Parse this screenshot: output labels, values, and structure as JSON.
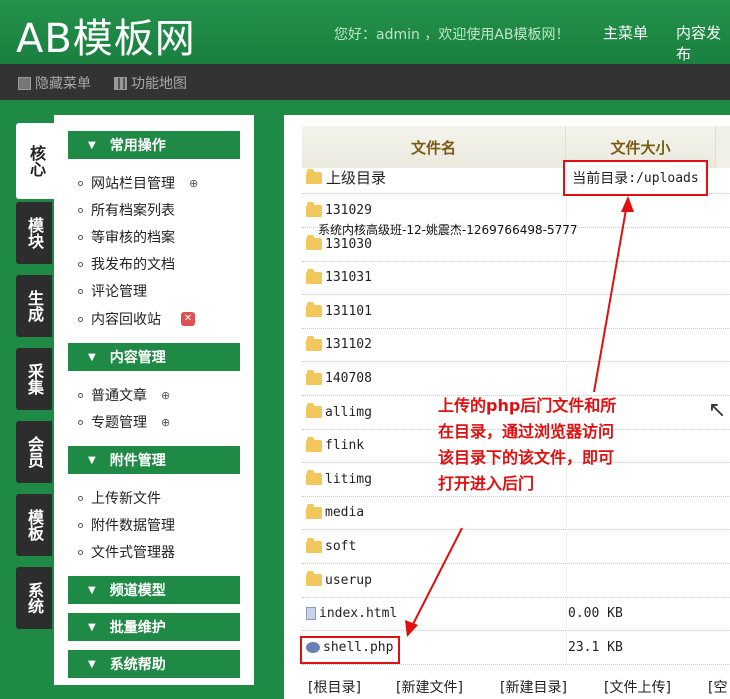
{
  "header": {
    "logo": "AB模板网",
    "welcome": "您好：admin ，欢迎使用AB模板网！",
    "nav": [
      "主菜单",
      "内容发布"
    ]
  },
  "subbar": {
    "items": [
      "隐藏菜单",
      "功能地图"
    ]
  },
  "vtabs": [
    "核心",
    "模块",
    "生成",
    "采集",
    "会员",
    "模板",
    "系统"
  ],
  "sidebar": {
    "groups": [
      {
        "title": "常用操作",
        "items": [
          "网站栏目管理",
          "所有档案列表",
          "等审核的档案",
          "我发布的文档",
          "评论管理",
          "内容回收站"
        ]
      },
      {
        "title": "内容管理",
        "items": [
          "普通文章",
          "专题管理"
        ]
      },
      {
        "title": "附件管理",
        "items": [
          "上传新文件",
          "附件数据管理",
          "文件式管理器"
        ]
      },
      {
        "title": "频道模型",
        "items": []
      },
      {
        "title": "批量维护",
        "items": []
      },
      {
        "title": "系统帮助",
        "items": []
      }
    ]
  },
  "filetable": {
    "headers": [
      "文件名",
      "文件大小"
    ],
    "updir": "上级目录",
    "current_dir_label": "当前目录",
    "current_dir_path": ":/uploads",
    "folders": [
      "131029",
      "131030",
      "131031",
      "131101",
      "131102",
      "140708",
      "allimg",
      "flink",
      "litimg",
      "media",
      "soft",
      "userup"
    ],
    "files": [
      {
        "name": "index.html",
        "size": "0.00 KB"
      },
      {
        "name": "shell.php",
        "size": "23.1 KB"
      }
    ],
    "bottom_buttons": [
      "[根目录]",
      "[新建文件]",
      "[新建目录]",
      "[文件上传]",
      "[空"
    ]
  },
  "watermark": "系统内核高级班-12-姚震杰-1269766498-5777",
  "annotation": "上传的php后门文件和所在目录，通过浏览器访问该目录下的该文件，即可打开进入后门",
  "colors": {
    "green": "#1e8a45",
    "dark": "#333333",
    "annotation_red": "#e01010"
  }
}
